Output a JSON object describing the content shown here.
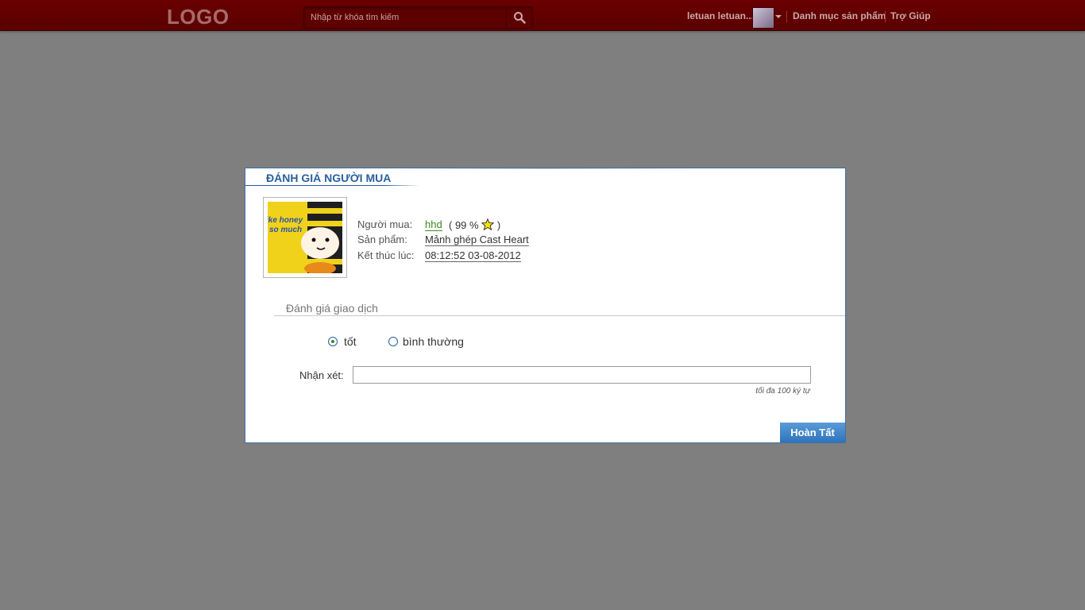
{
  "header": {
    "logo": "LOGO",
    "search_placeholder": "Nhập từ khóa tìm kiếm",
    "user_name": "letuan letuan...",
    "nav": [
      "Danh mục sản phẩm",
      "Trợ Giúp"
    ]
  },
  "dialog": {
    "title": "ĐÁNH GIÁ NGƯỜI MUA",
    "product_image_text": [
      "ike honey",
      "so much"
    ],
    "buyer_label": "Người mua:",
    "buyer_name": "hhd",
    "buyer_rating_open": "( 99 %",
    "buyer_rating_close": ")",
    "product_label": "Sản phẩm:",
    "product_name": "Mảnh ghép Cast Heart",
    "end_label": "Kết thúc lúc:",
    "end_time": "08:12:52 03-08-2012",
    "section_title": "Đánh giá giao dịch",
    "options": [
      "tốt",
      "bình thường"
    ],
    "selected_option": "tốt",
    "comment_label": "Nhận xét:",
    "comment_value": "",
    "comment_hint": "tối đa 100 ký tự",
    "submit_label": "Hoàn Tất"
  },
  "colors": {
    "header_bg": "#5f0000",
    "page_bg": "#7f7f7f",
    "title_blue": "#2a5f9c",
    "buyer_green": "#3f8a1e",
    "submit_bg": "#3f86c9"
  }
}
